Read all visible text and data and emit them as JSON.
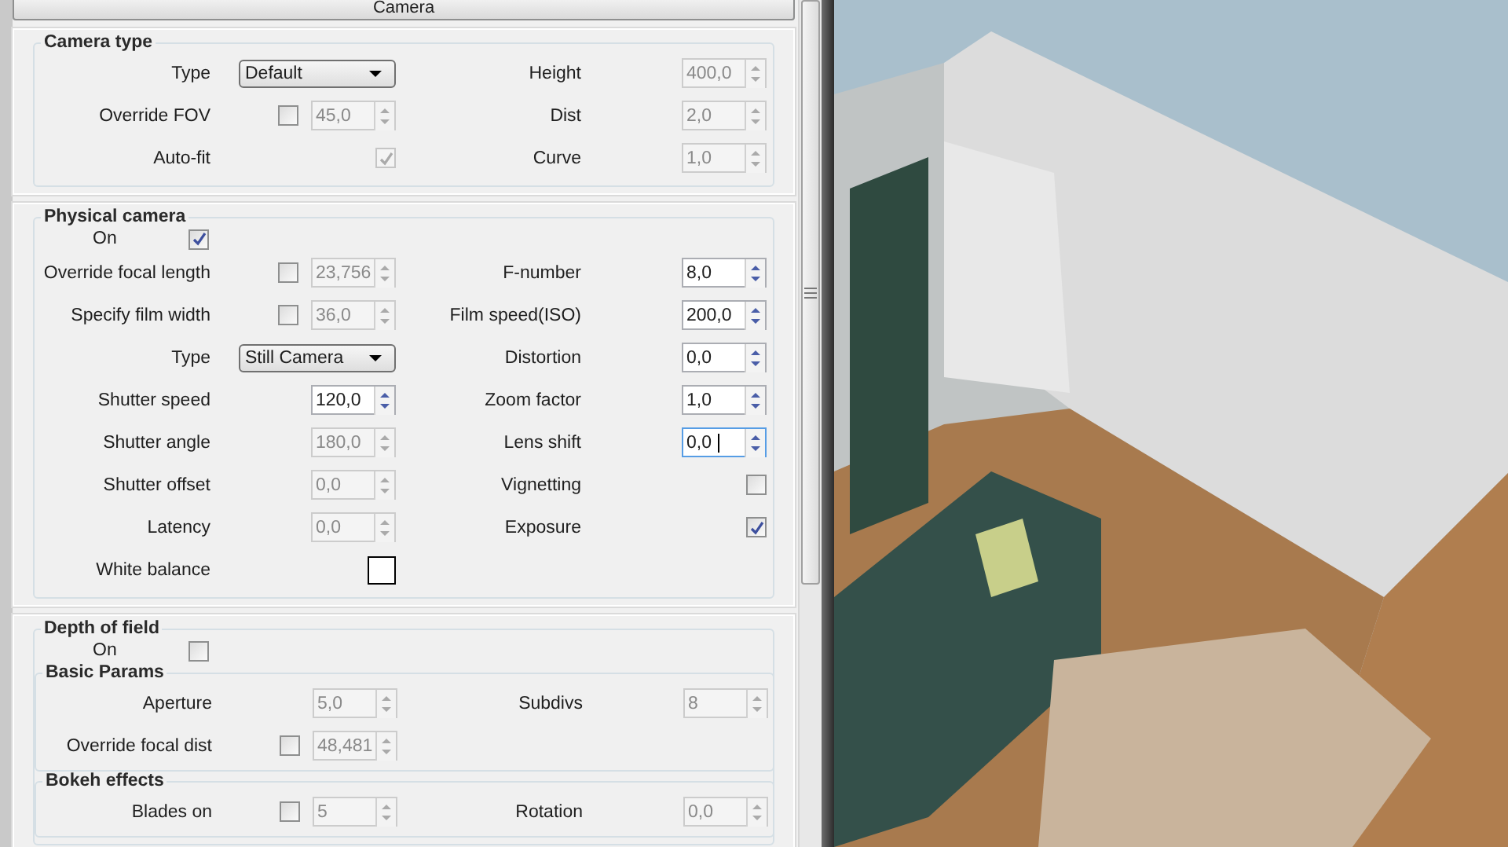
{
  "panel_title": "Camera",
  "sections": [
    {
      "title": "Camera type",
      "rows": [
        {
          "left": {
            "kind": "dropdown",
            "label": "Type",
            "value": "Default"
          },
          "right": {
            "kind": "spin",
            "label": "Height",
            "value": "400,0",
            "disabled": true,
            "focused": false
          }
        },
        {
          "left": {
            "kind": "checkbox_spin",
            "label": "Override FOV",
            "checked": false,
            "value": "45,0",
            "disabled": true
          },
          "right": {
            "kind": "spin",
            "label": "Dist",
            "value": "2,0",
            "disabled": true,
            "focused": false
          }
        },
        {
          "left": {
            "kind": "checkbox",
            "label": "Auto-fit",
            "checked": true,
            "disabled": true
          },
          "right": {
            "kind": "spin",
            "label": "Curve",
            "value": "1,0",
            "disabled": true,
            "focused": false
          }
        }
      ]
    },
    {
      "title": "Physical camera",
      "toggle": {
        "label": "On",
        "checked": true
      },
      "rows": [
        {
          "left": {
            "kind": "checkbox_spin",
            "label": "Override focal length",
            "checked": false,
            "value": "23,756",
            "disabled": true
          },
          "right": {
            "kind": "spin",
            "label": "F-number",
            "value": "8,0",
            "disabled": false,
            "focused": false
          }
        },
        {
          "left": {
            "kind": "checkbox_spin",
            "label": "Specify film width",
            "checked": false,
            "value": "36,0",
            "disabled": true
          },
          "right": {
            "kind": "spin",
            "label": "Film speed(ISO)",
            "value": "200,0",
            "disabled": false,
            "focused": false
          }
        },
        {
          "left": {
            "kind": "dropdown",
            "label": "Type",
            "value": "Still Camera"
          },
          "right": {
            "kind": "spin",
            "label": "Distortion",
            "value": "0,0",
            "disabled": false,
            "focused": false
          }
        },
        {
          "left": {
            "kind": "spin",
            "label": "Shutter speed",
            "value": "120,0",
            "disabled": false,
            "focused": false
          },
          "right": {
            "kind": "spin",
            "label": "Zoom factor",
            "value": "1,0",
            "disabled": false,
            "focused": false
          }
        },
        {
          "left": {
            "kind": "spin",
            "label": "Shutter angle",
            "value": "180,0",
            "disabled": true,
            "focused": false
          },
          "right": {
            "kind": "spin",
            "label": "Lens shift",
            "value": "0,0",
            "disabled": false,
            "focused": true
          }
        },
        {
          "left": {
            "kind": "spin",
            "label": "Shutter offset",
            "value": "0,0",
            "disabled": true,
            "focused": false
          },
          "right": {
            "kind": "checkbox",
            "label": "Vignetting",
            "checked": false,
            "disabled": false
          }
        },
        {
          "left": {
            "kind": "spin",
            "label": "Latency",
            "value": "0,0",
            "disabled": true,
            "focused": false
          },
          "right": {
            "kind": "checkbox",
            "label": "Exposure",
            "checked": true,
            "disabled": false
          }
        },
        {
          "left": {
            "kind": "color",
            "label": "White balance",
            "color": "#ffffff"
          },
          "right": null
        }
      ]
    },
    {
      "title": "Depth of field",
      "toggle": {
        "label": "On",
        "checked": false
      },
      "subgroups": [
        {
          "title": "Basic Params",
          "rows": [
            {
              "left": {
                "kind": "spin",
                "label": "Aperture",
                "value": "5,0",
                "disabled": true,
                "focused": false
              },
              "right": {
                "kind": "spin",
                "label": "Subdivs",
                "value": "8",
                "disabled": true,
                "focused": false
              }
            },
            {
              "left": {
                "kind": "checkbox_spin",
                "label": "Override focal dist",
                "checked": false,
                "value": "48,481",
                "disabled": true
              },
              "right": null
            }
          ]
        },
        {
          "title": "Bokeh effects",
          "rows": [
            {
              "left": {
                "kind": "checkbox_spin",
                "label": "Blades on",
                "checked": false,
                "value": "5",
                "disabled": true
              },
              "right": {
                "kind": "spin",
                "label": "Rotation",
                "value": "0,0",
                "disabled": true,
                "focused": false
              }
            }
          ]
        }
      ]
    }
  ]
}
